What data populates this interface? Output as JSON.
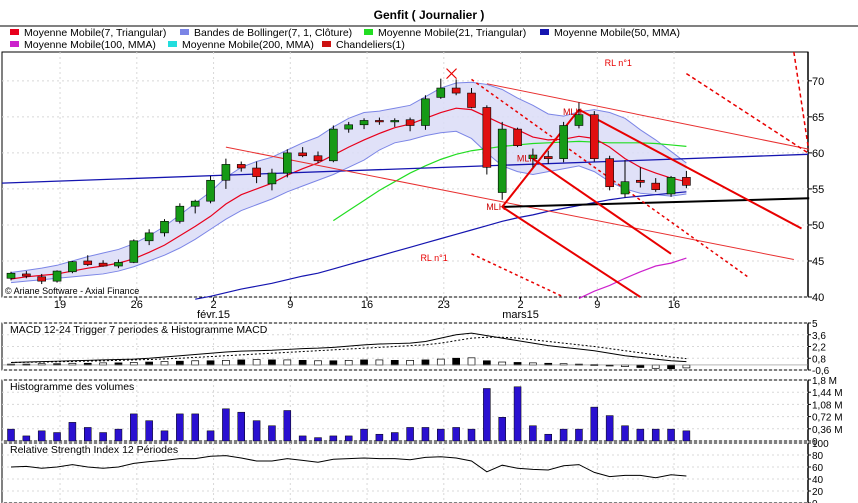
{
  "chart_data": {
    "type": "candlestick",
    "title": "Genfit  ( Journalier )",
    "legend": [
      {
        "label": "Moyenne Mobile(7, Triangular)",
        "color": "#e8001c"
      },
      {
        "label": "Bandes de Bollinger(7, 1, Clôture)",
        "color": "#7b85e6"
      },
      {
        "label": "Moyenne Mobile(21, Triangular)",
        "color": "#22dd22"
      },
      {
        "label": "Moyenne Mobile(50, MMA)",
        "color": "#1515b0"
      },
      {
        "label": "Moyenne Mobile(100, MMA)",
        "color": "#cc22cc"
      },
      {
        "label": "Moyenne Mobile(200, MMA)",
        "color": "#22dddd"
      },
      {
        "label": "Chandeliers(1)",
        "color": "#cc1111"
      }
    ],
    "credit": "© Ariane Software - Axial Finance",
    "xticks": [
      {
        "day": "19",
        "month": ""
      },
      {
        "day": "26",
        "month": ""
      },
      {
        "day": "2",
        "month": "févr.15"
      },
      {
        "day": "9",
        "month": ""
      },
      {
        "day": "16",
        "month": ""
      },
      {
        "day": "23",
        "month": ""
      },
      {
        "day": "2",
        "month": "mars15"
      },
      {
        "day": "9",
        "month": ""
      },
      {
        "day": "16",
        "month": ""
      }
    ],
    "price_ylim": [
      40,
      74
    ],
    "price_yticks": [
      "70",
      "65",
      "60",
      "55",
      "50",
      "45",
      "40"
    ],
    "price_ytick_values": [
      70,
      65,
      60,
      55,
      50,
      45,
      40
    ],
    "candles": [
      {
        "o": 42.6,
        "h": 43.5,
        "l": 42.3,
        "c": 43.3
      },
      {
        "o": 43.2,
        "h": 43.6,
        "l": 42.6,
        "c": 42.9
      },
      {
        "o": 42.8,
        "h": 43.2,
        "l": 41.8,
        "c": 42.2
      },
      {
        "o": 42.2,
        "h": 43.7,
        "l": 42.0,
        "c": 43.6
      },
      {
        "o": 43.5,
        "h": 45.0,
        "l": 43.3,
        "c": 44.9
      },
      {
        "o": 45.0,
        "h": 45.8,
        "l": 44.3,
        "c": 44.5
      },
      {
        "o": 44.7,
        "h": 45.1,
        "l": 44.2,
        "c": 44.3
      },
      {
        "o": 44.3,
        "h": 45.2,
        "l": 44.0,
        "c": 44.8
      },
      {
        "o": 44.8,
        "h": 48.0,
        "l": 44.7,
        "c": 47.8
      },
      {
        "o": 47.8,
        "h": 49.4,
        "l": 47.2,
        "c": 48.9
      },
      {
        "o": 48.9,
        "h": 50.8,
        "l": 48.4,
        "c": 50.5
      },
      {
        "o": 50.5,
        "h": 53.0,
        "l": 50.2,
        "c": 52.6
      },
      {
        "o": 52.6,
        "h": 53.5,
        "l": 51.6,
        "c": 53.3
      },
      {
        "o": 53.3,
        "h": 56.8,
        "l": 53.0,
        "c": 56.2
      },
      {
        "o": 56.2,
        "h": 59.2,
        "l": 55.0,
        "c": 58.4
      },
      {
        "o": 58.4,
        "h": 58.8,
        "l": 57.4,
        "c": 57.9
      },
      {
        "o": 57.9,
        "h": 58.8,
        "l": 55.8,
        "c": 56.7
      },
      {
        "o": 55.7,
        "h": 57.8,
        "l": 54.8,
        "c": 57.2
      },
      {
        "o": 57.2,
        "h": 60.5,
        "l": 56.6,
        "c": 60.0
      },
      {
        "o": 60.0,
        "h": 60.8,
        "l": 59.4,
        "c": 59.6
      },
      {
        "o": 59.6,
        "h": 60.2,
        "l": 58.6,
        "c": 58.9
      },
      {
        "o": 58.9,
        "h": 63.8,
        "l": 58.7,
        "c": 63.3
      },
      {
        "o": 63.3,
        "h": 64.3,
        "l": 62.8,
        "c": 63.9
      },
      {
        "o": 63.9,
        "h": 64.8,
        "l": 63.3,
        "c": 64.5
      },
      {
        "o": 64.5,
        "h": 64.9,
        "l": 63.9,
        "c": 64.3
      },
      {
        "o": 64.3,
        "h": 64.8,
        "l": 63.6,
        "c": 64.5
      },
      {
        "o": 64.6,
        "h": 64.9,
        "l": 63.0,
        "c": 63.8
      },
      {
        "o": 63.8,
        "h": 68.0,
        "l": 63.2,
        "c": 67.5
      },
      {
        "o": 67.7,
        "h": 70.3,
        "l": 67.5,
        "c": 69.0
      },
      {
        "o": 69.0,
        "h": 70.2,
        "l": 68.0,
        "c": 68.3
      },
      {
        "o": 68.3,
        "h": 69.0,
        "l": 66.2,
        "c": 66.3
      },
      {
        "o": 66.3,
        "h": 66.6,
        "l": 57.0,
        "c": 58.0
      },
      {
        "o": 54.5,
        "h": 64.3,
        "l": 53.5,
        "c": 63.3
      },
      {
        "o": 63.3,
        "h": 63.5,
        "l": 60.8,
        "c": 61.0
      },
      {
        "o": 59.2,
        "h": 60.6,
        "l": 58.0,
        "c": 59.7
      },
      {
        "o": 59.5,
        "h": 60.3,
        "l": 58.5,
        "c": 59.2
      },
      {
        "o": 59.2,
        "h": 64.3,
        "l": 58.7,
        "c": 63.8
      },
      {
        "o": 63.8,
        "h": 67.0,
        "l": 63.4,
        "c": 65.3
      },
      {
        "o": 65.3,
        "h": 65.8,
        "l": 58.8,
        "c": 59.2
      },
      {
        "o": 59.2,
        "h": 59.6,
        "l": 54.8,
        "c": 55.3
      },
      {
        "o": 54.3,
        "h": 59.0,
        "l": 53.8,
        "c": 56.0
      },
      {
        "o": 56.2,
        "h": 58.0,
        "l": 55.2,
        "c": 55.9
      },
      {
        "o": 55.8,
        "h": 56.5,
        "l": 54.6,
        "c": 54.9
      },
      {
        "o": 54.3,
        "h": 56.8,
        "l": 53.9,
        "c": 56.6
      },
      {
        "o": 56.6,
        "h": 57.5,
        "l": 55.1,
        "c": 55.5
      }
    ],
    "ma7": [
      42.5,
      42.8,
      43.0,
      43.2,
      43.6,
      44.0,
      44.3,
      44.7,
      45.3,
      46.2,
      47.2,
      48.5,
      49.8,
      51.2,
      52.9,
      54.2,
      55.0,
      55.8,
      56.9,
      57.8,
      58.6,
      59.7,
      60.8,
      61.8,
      62.7,
      63.5,
      64.0,
      64.8,
      65.6,
      66.2,
      66.0,
      65.0,
      64.0,
      63.2,
      62.2,
      61.8,
      61.9,
      62.3,
      62.0,
      60.8,
      59.2,
      58.0,
      57.2,
      56.5,
      56.0
    ],
    "boll_upper": [
      43.4,
      43.7,
      44.0,
      44.4,
      45.0,
      45.6,
      46.1,
      46.6,
      47.4,
      48.5,
      49.8,
      51.4,
      53.0,
      54.6,
      56.6,
      58.0,
      58.8,
      59.4,
      60.4,
      61.4,
      62.2,
      63.6,
      64.8,
      65.6,
      65.8,
      66.2,
      66.6,
      67.8,
      69.0,
      69.7,
      69.8,
      69.5,
      68.8,
      67.6,
      66.6,
      65.4,
      65.1,
      65.7,
      66.0,
      65.6,
      64.8,
      63.2,
      61.8,
      60.2,
      58.6
    ],
    "boll_lower": [
      42.0,
      42.2,
      42.4,
      42.6,
      42.8,
      43.0,
      43.2,
      43.6,
      44.2,
      45.0,
      45.8,
      46.8,
      48.0,
      49.4,
      50.8,
      52.0,
      52.8,
      53.6,
      54.6,
      55.4,
      56.2,
      57.0,
      58.0,
      59.0,
      60.4,
      61.4,
      61.8,
      62.4,
      62.8,
      63.0,
      62.0,
      60.0,
      58.2,
      57.4,
      57.0,
      57.4,
      57.8,
      58.2,
      57.4,
      56.0,
      55.0,
      54.4,
      54.2,
      54.0,
      54.3
    ],
    "ma21": [
      null,
      null,
      null,
      null,
      null,
      null,
      null,
      null,
      null,
      null,
      null,
      null,
      null,
      null,
      null,
      null,
      null,
      null,
      null,
      null,
      null,
      50.6,
      52.0,
      53.4,
      54.8,
      56.0,
      57.2,
      58.2,
      59.1,
      59.8,
      60.3,
      60.6,
      60.9,
      61.1,
      61.3,
      61.4,
      61.5,
      61.6,
      61.5,
      61.4,
      61.4,
      61.4,
      61.3,
      61.1,
      60.9
    ],
    "ma50": [
      null,
      null,
      null,
      null,
      null,
      null,
      null,
      null,
      null,
      null,
      null,
      null,
      39.7,
      40.1,
      40.6,
      41.1,
      41.5,
      41.9,
      42.4,
      42.9,
      43.3,
      43.9,
      44.5,
      45.1,
      45.7,
      46.3,
      46.9,
      47.5,
      48.1,
      48.7,
      49.3,
      49.9,
      50.5,
      51.0,
      51.4,
      51.9,
      52.3,
      52.7,
      53.1,
      53.5,
      53.8,
      54.0,
      54.2,
      54.4,
      54.6
    ],
    "ma100": [
      null,
      null,
      null,
      null,
      null,
      null,
      null,
      null,
      null,
      null,
      null,
      null,
      null,
      null,
      null,
      null,
      null,
      null,
      null,
      null,
      null,
      null,
      null,
      null,
      null,
      null,
      null,
      null,
      null,
      null,
      null,
      null,
      null,
      null,
      null,
      null,
      null,
      39.8,
      40.8,
      41.6,
      42.6,
      43.5,
      44.3,
      44.7,
      45.4
    ],
    "annotations": [
      {
        "text": "MLH",
        "date_index": 32,
        "price": 52.5
      },
      {
        "text": "MLH",
        "date_index": 34,
        "price": 59.2
      },
      {
        "text": "MLH",
        "date_index": 37,
        "price": 65.7
      },
      {
        "text": "RL n°1",
        "date_index": 39,
        "price": 72.5
      },
      {
        "text": "RL n°1",
        "date_index": 27,
        "price": 45.4
      }
    ],
    "macd": {
      "title": "MACD 12-24   Trigger 7 periodes & Histogramme MACD",
      "ylim": [
        -0.6,
        5
      ],
      "yticks": [
        "5",
        "3,6",
        "2,2",
        "0,8",
        "-0,6"
      ],
      "ytick_values": [
        5,
        3.6,
        2.2,
        0.8,
        -0.6
      ],
      "macd": [
        0.3,
        0.35,
        0.4,
        0.45,
        0.5,
        0.55,
        0.6,
        0.65,
        0.7,
        0.8,
        0.95,
        1.1,
        1.25,
        1.4,
        1.55,
        1.65,
        1.7,
        1.75,
        1.85,
        1.95,
        2.0,
        2.1,
        2.25,
        2.4,
        2.5,
        2.55,
        2.6,
        2.8,
        3.2,
        3.6,
        3.8,
        3.5,
        3.2,
        2.9,
        2.6,
        2.3,
        2.1,
        1.9,
        1.7,
        1.4,
        1.1,
        0.9,
        0.7,
        0.5,
        0.4
      ],
      "trigger": [
        0.3,
        0.32,
        0.35,
        0.38,
        0.42,
        0.46,
        0.5,
        0.55,
        0.6,
        0.65,
        0.72,
        0.8,
        0.9,
        1.0,
        1.1,
        1.2,
        1.3,
        1.4,
        1.5,
        1.6,
        1.7,
        1.8,
        1.9,
        2.0,
        2.1,
        2.2,
        2.3,
        2.4,
        2.6,
        2.9,
        3.2,
        3.3,
        3.3,
        3.2,
        3.0,
        2.8,
        2.6,
        2.4,
        2.2,
        1.95,
        1.7,
        1.45,
        1.2,
        0.95,
        0.75
      ],
      "histogram": [
        0.1,
        0.1,
        0.15,
        0.15,
        0.2,
        0.2,
        0.25,
        0.25,
        0.3,
        0.35,
        0.4,
        0.45,
        0.5,
        0.5,
        0.55,
        0.6,
        0.65,
        0.6,
        0.6,
        0.55,
        0.5,
        0.5,
        0.55,
        0.6,
        0.6,
        0.55,
        0.55,
        0.6,
        0.7,
        0.8,
        0.85,
        0.5,
        0.35,
        0.3,
        0.25,
        0.2,
        0.15,
        0.1,
        0.05,
        -0.1,
        -0.2,
        -0.3,
        -0.4,
        -0.45,
        -0.35
      ]
    },
    "volume": {
      "title": "Histogramme des volumes",
      "ylim": [
        0,
        1.8
      ],
      "yticks": [
        "1,8 M",
        "1,44 M",
        "1,08 M",
        "0,72 M",
        "0,36 M",
        "0"
      ],
      "ytick_values": [
        1.8,
        1.44,
        1.08,
        0.72,
        0.36,
        0
      ],
      "values": [
        0.35,
        0.15,
        0.3,
        0.25,
        0.55,
        0.4,
        0.25,
        0.35,
        0.8,
        0.6,
        0.3,
        0.8,
        0.8,
        0.3,
        0.95,
        0.85,
        0.6,
        0.45,
        0.9,
        0.15,
        0.1,
        0.15,
        0.15,
        0.35,
        0.2,
        0.25,
        0.4,
        0.4,
        0.35,
        0.4,
        0.35,
        1.55,
        0.7,
        1.6,
        0.45,
        0.2,
        0.35,
        0.35,
        1.0,
        0.75,
        0.45,
        0.35,
        0.35,
        0.35,
        0.3
      ]
    },
    "rsi": {
      "title": "Relative Strength Index 12 Périodes",
      "ylim": [
        0,
        100
      ],
      "yticks": [
        "100",
        "80",
        "60",
        "40",
        "20",
        "0"
      ],
      "ytick_values": [
        100,
        80,
        60,
        40,
        20,
        0
      ],
      "values": [
        60,
        61,
        58,
        60,
        64,
        60,
        58,
        60,
        66,
        69,
        71,
        74,
        74,
        78,
        79,
        75,
        70,
        70,
        74,
        71,
        68,
        73,
        74,
        75,
        74,
        74,
        72,
        76,
        77,
        75,
        70,
        52,
        63,
        58,
        56,
        55,
        62,
        64,
        51,
        44,
        46,
        46,
        42,
        47,
        45
      ]
    }
  }
}
